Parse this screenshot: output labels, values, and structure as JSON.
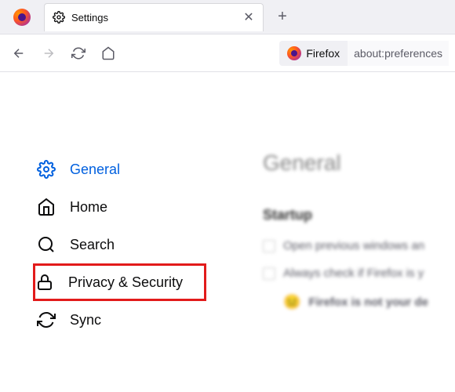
{
  "tab": {
    "label": "Settings"
  },
  "toolbar": {
    "identity_label": "Firefox",
    "url": "about:preferences"
  },
  "sidebar": {
    "items": [
      {
        "label": "General"
      },
      {
        "label": "Home"
      },
      {
        "label": "Search"
      },
      {
        "label": "Privacy & Security"
      },
      {
        "label": "Sync"
      }
    ]
  },
  "main": {
    "heading": "General",
    "section1": "Startup",
    "check1": "Open previous windows an",
    "check2": "Always check if Firefox is y",
    "status": "Firefox is not your de"
  }
}
